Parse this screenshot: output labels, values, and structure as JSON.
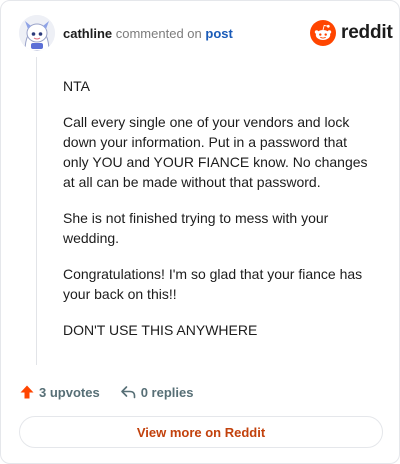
{
  "comment": {
    "username": "cathline",
    "action_text": "commented on",
    "post_link_label": "post",
    "paragraphs": [
      "NTA",
      "Call every single one of your vendors and lock down your information. Put in a password that only YOU and YOUR FIANCE know. No changes at all can be made without that password.",
      "She is not finished trying to mess with your wedding.",
      "Congratulations! I'm so glad that your fiance has your back on this!!",
      "DON'T USE THIS ANYWHERE"
    ],
    "upvotes_label": "3 upvotes",
    "replies_label": "0 replies"
  },
  "brand": {
    "logo_text": "reddit",
    "accent_color": "#ff4500"
  },
  "icons": {
    "upvote": "upvote-arrow-icon",
    "reply": "reply-arrow-icon",
    "logo": "reddit-snoo-icon",
    "avatar": "user-avatar"
  },
  "cta": {
    "label": "View more on Reddit",
    "color": "#c2410c"
  }
}
